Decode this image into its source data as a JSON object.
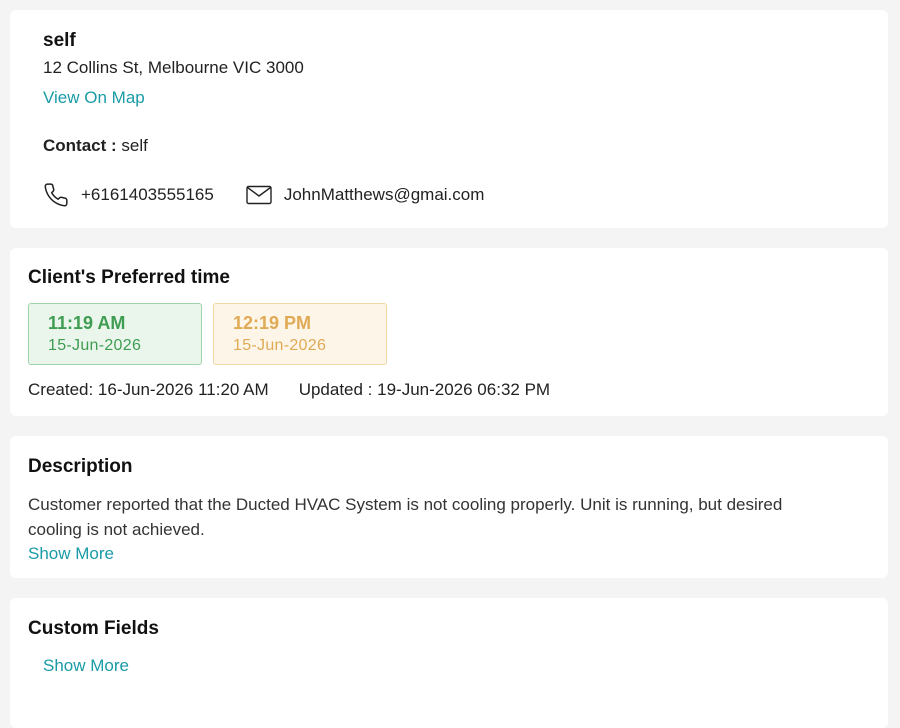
{
  "customer": {
    "name": "self",
    "address": "12 Collins St, Melbourne VIC 3000",
    "map_link": "View On Map",
    "contact_label": "Contact :",
    "contact_value": "self",
    "phone": "+6161403555165",
    "email": "JohnMatthews@gmai.com"
  },
  "preferred_time": {
    "title": "Client's Preferred time",
    "slots": [
      {
        "time": "11:19 AM",
        "date": "15-Jun-2026",
        "color": "#3f9d52"
      },
      {
        "time": "12:19 PM",
        "date": "15-Jun-2026",
        "color": "#e0aa55"
      }
    ],
    "created": "Created: 16-Jun-2026 11:20 AM",
    "updated": "Updated : 19-Jun-2026 06:32 PM"
  },
  "description": {
    "title": "Description",
    "text": "Customer reported that the Ducted HVAC System is not cooling properly. Unit is running, but desired cooling is not achieved.",
    "show_more": "Show More"
  },
  "custom_fields": {
    "title": "Custom Fields",
    "show_more": "Show More"
  },
  "icons": {
    "phone": "phone-icon",
    "email": "mail-icon"
  },
  "colors": {
    "link": "#1a9ba6",
    "background": "#f4f4f5"
  }
}
